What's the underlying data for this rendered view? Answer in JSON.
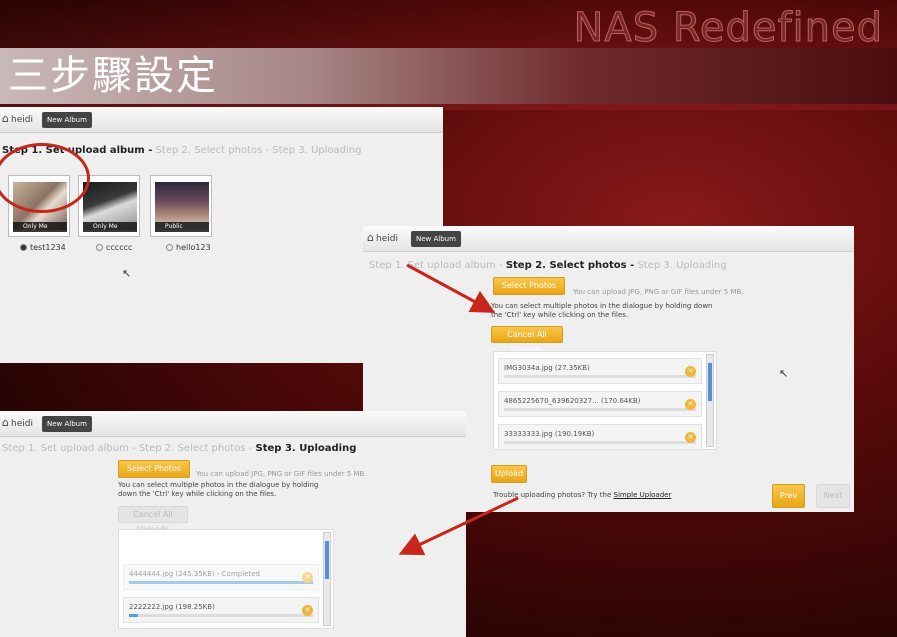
{
  "slide": {
    "brand": "NAS Redefined",
    "title": "三步驟設定"
  },
  "panel1": {
    "home_label": "heidi",
    "new_album": "New Album",
    "step1": "Step 1. Set upload album -",
    "step2": "Step 2. Select photos -",
    "step3": "Step 3. Uploading",
    "albums": [
      {
        "name": "test1234",
        "meta": "Only Me",
        "checked": true
      },
      {
        "name": "cccccc",
        "meta": "Only Me",
        "checked": false
      },
      {
        "name": "hello123",
        "meta": "Public",
        "checked": false
      }
    ]
  },
  "panel2": {
    "home_label": "heidi",
    "new_album": "New Album",
    "step1": "Step 1. Set upload album -",
    "step2": "Step 2. Select photos -",
    "step3": "Step 3. Uploading",
    "select_photos": "Select Photos",
    "size_hint": "You can upload JPG, PNG or GIF files under 5 MB.",
    "multi_hint": "You can select multiple photos in the dialogue by holding down the 'Ctrl' key while clicking on the files.",
    "cancel_all": "Cancel All Uploads",
    "files": [
      {
        "name": "IMG3034a.jpg (27.35KB)",
        "progress": 0
      },
      {
        "name": "4865225670_639620327... (170.64KB)",
        "progress": 0
      },
      {
        "name": "33333333.jpg (190.19KB)",
        "progress": 0
      }
    ],
    "upload": "Upload",
    "help_prefix": "Trouble uploading photos? Try the",
    "help_link": "Simple Uploader",
    "prev": "Prev",
    "next": "Next"
  },
  "panel3": {
    "home_label": "heidi",
    "new_album": "New Album",
    "step1": "Step 1. Set upload album -",
    "step2": "Step 2. Select photos -",
    "step3": "Step 3. Uploading",
    "select_photos": "Select Photos",
    "size_hint": "You can upload JPG, PNG or GIF files under 5 MB.",
    "multi_hint": "You can select multiple photos in the dialogue by holding down the 'Ctrl' key while clicking on the files.",
    "cancel_all": "Cancel All Uploads",
    "files": [
      {
        "name": "4444444.jpg (245.35KB) - Completed",
        "progress": 1
      },
      {
        "name": "2222222.jpg (198.25KB)",
        "progress": 0.05
      }
    ]
  },
  "colors": {
    "accent": "#f0b53a",
    "arrow": "#c8261c",
    "background": "#5a0a0a"
  }
}
